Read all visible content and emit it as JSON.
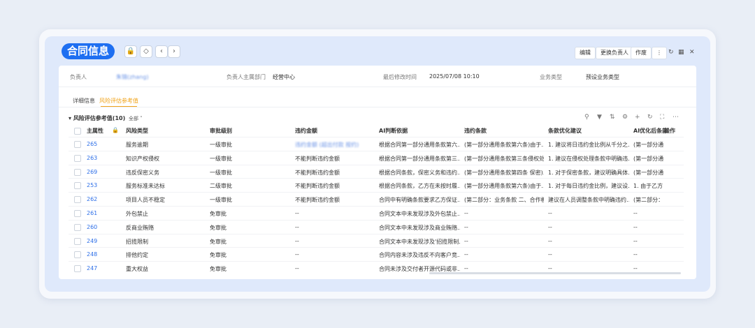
{
  "title": "合同信息",
  "header": {
    "buttons": [
      "编辑",
      "更换负责人",
      "作废"
    ],
    "icons": [
      "lock-icon",
      "tag-icon",
      "prev-icon",
      "next-icon",
      "more-icon",
      "refresh-icon",
      "fullscreen-icon",
      "close-icon"
    ]
  },
  "info": {
    "owner_label": "负责人",
    "owner_value": "朱锦(zhang)",
    "dept_label": "负责人主属部门",
    "dept_value": "经营中心",
    "modified_label": "最后修改时间",
    "modified_value": "2025/07/08 10:10",
    "biztype_label": "业务类型",
    "biztype_value": "预设业务类型"
  },
  "tabs": [
    "详细信息",
    "风险评估参考值"
  ],
  "section": {
    "title": "风险评估参考值(10)",
    "filter": "全部"
  },
  "table": {
    "columns": [
      "主属性",
      "风险类型",
      "审批级别",
      "违约金额",
      "AI判断依据",
      "违约条款",
      "条款优化建议",
      "AI优化后条款",
      "操作"
    ],
    "rows": [
      {
        "id": "265",
        "type": "服务逾期",
        "level": "一级审批",
        "amount": "违约金额 (超出付款 按约)",
        "basis": "根据合同第一部分通用条款第六…",
        "clause": "(第一部分通用条款第六条)由于…",
        "advice": "1. 建议将日违约金比例从千分之…",
        "optimized": "(第一部分通"
      },
      {
        "id": "263",
        "type": "知识产权侵权",
        "level": "一级审批",
        "amount": "不能判断违约金额",
        "basis": "根据合同第一部分通用条款第三…",
        "clause": "(第一部分通用条款第三条侵权处…",
        "advice": "1. 建议在侵权处理条款中明确违…",
        "optimized": "(第一部分通"
      },
      {
        "id": "269",
        "type": "违反保密义务",
        "level": "一级审批",
        "amount": "不能判断违约金额",
        "basis": "根据合同条款，保密义务和违约…",
        "clause": "(第一部分通用条款第四条 保密)…",
        "advice": "1. 对于保密条款，建议明确具体…",
        "optimized": "(第一部分通"
      },
      {
        "id": "253",
        "type": "服务标准未达标",
        "level": "二级审批",
        "amount": "不能判断违约金额",
        "basis": "根据合同条款，乙方在未按时履…",
        "clause": "(第一部分通用条款第六条)由于…",
        "advice": "1. 对于每日违约金比例，建议设…",
        "optimized": "1. 由于乙方"
      },
      {
        "id": "262",
        "type": "项目人员不稳定",
        "level": "一级审批",
        "amount": "不能判断违约金额",
        "basis": "合同中有明确条款要求乙方保证…",
        "clause": "(第二部分：业务条款 二、合作模…",
        "advice": "建议在人员调整条款中明确违约…",
        "optimized": "(第二部分：:"
      },
      {
        "id": "261",
        "type": "外包禁止",
        "level": "免审批",
        "amount": "--",
        "basis": "合同文本中未发现涉及外包禁止…",
        "clause": "--",
        "advice": "--",
        "optimized": "--"
      },
      {
        "id": "260",
        "type": "反商业贿赂",
        "level": "免审批",
        "amount": "--",
        "basis": "合同文本中未发现涉及商业贿赂…",
        "clause": "--",
        "advice": "--",
        "optimized": "--"
      },
      {
        "id": "249",
        "type": "招揽限制",
        "level": "免审批",
        "amount": "--",
        "basis": "合同文本中未发现涉及'招揽限制…",
        "clause": "--",
        "advice": "--",
        "optimized": "--"
      },
      {
        "id": "248",
        "type": "排他约定",
        "level": "免审批",
        "amount": "--",
        "basis": "合同内容未涉及违反不向客户竞…",
        "clause": "--",
        "advice": "--",
        "optimized": "--"
      },
      {
        "id": "247",
        "type": "重大权益",
        "level": "免审批",
        "amount": "--",
        "basis": "合同未涉及交付者开源代码或非…",
        "clause": "--",
        "advice": "--",
        "optimized": "--"
      }
    ]
  }
}
